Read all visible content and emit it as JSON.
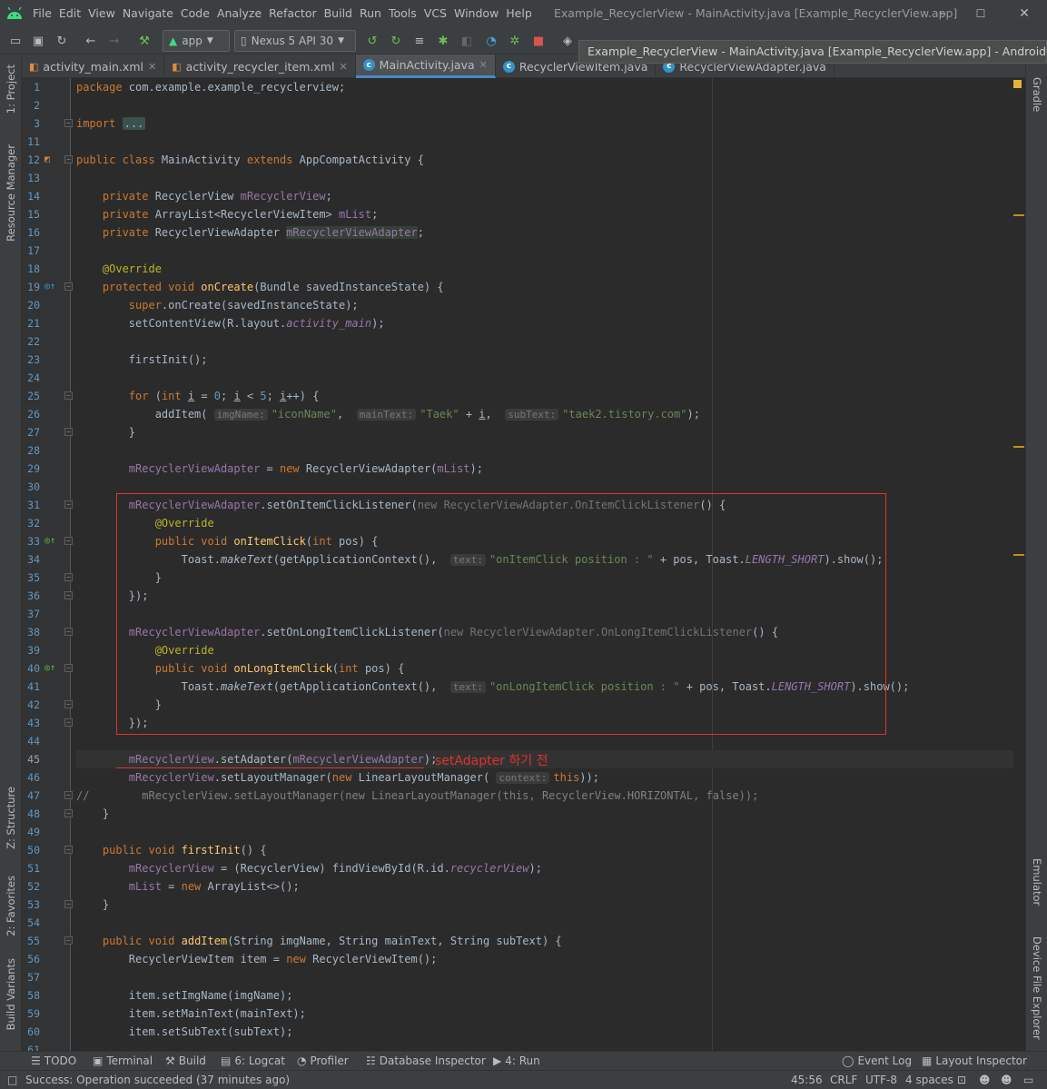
{
  "window": {
    "menus": [
      "File",
      "Edit",
      "View",
      "Navigate",
      "Code",
      "Analyze",
      "Refactor",
      "Build",
      "Run",
      "Tools",
      "VCS",
      "Window",
      "Help"
    ],
    "title": "Example_RecyclerView - MainActivity.java [Example_RecyclerView.app]",
    "minimize": "–",
    "maximize": "☐",
    "close": "✕"
  },
  "toolbar": {
    "run_config": "app",
    "device": "Nexus 5 API 30"
  },
  "tooltip": "Example_RecyclerView - MainActivity.java [Example_RecyclerView.app] - Android Studio 4.1.2",
  "left_tabs": [
    "1: Project",
    "Resource Manager",
    "Z: Structure",
    "2: Favorites",
    "Build Variants"
  ],
  "right_tabs": [
    "Gradle",
    "Emulator",
    "Device File Explorer"
  ],
  "tabs": [
    {
      "label": "activity_main.xml",
      "type": "xml"
    },
    {
      "label": "activity_recycler_item.xml",
      "type": "xml"
    },
    {
      "label": "MainActivity.java",
      "type": "java"
    },
    {
      "label": "RecyclerViewItem.java",
      "type": "java"
    },
    {
      "label": "RecyclerViewAdapter.java",
      "type": "java"
    }
  ],
  "editor": {
    "line_numbers": [
      "1",
      "2",
      "3",
      "11",
      "12",
      "13",
      "14",
      "15",
      "16",
      "17",
      "18",
      "19",
      "20",
      "21",
      "22",
      "23",
      "24",
      "25",
      "26",
      "27",
      "28",
      "29",
      "30",
      "31",
      "32",
      "33",
      "34",
      "35",
      "36",
      "37",
      "38",
      "39",
      "40",
      "41",
      "42",
      "43",
      "44",
      "45",
      "46",
      "47",
      "48",
      "49",
      "50",
      "51",
      "52",
      "53",
      "54",
      "55",
      "56",
      "57",
      "58",
      "59",
      "60",
      "61"
    ],
    "current_line": "45",
    "annotation": "setAdapter 하기 전"
  },
  "bottom_tools": [
    "TODO",
    "Terminal",
    "Build",
    "6: Logcat",
    "Profiler",
    "Database Inspector",
    "4: Run",
    "Event Log",
    "Layout Inspector"
  ],
  "status": {
    "message": "Success: Operation succeeded (37 minutes ago)",
    "position": "45:56",
    "line_sep": "CRLF",
    "encoding": "UTF-8",
    "indent": "4 spaces"
  }
}
